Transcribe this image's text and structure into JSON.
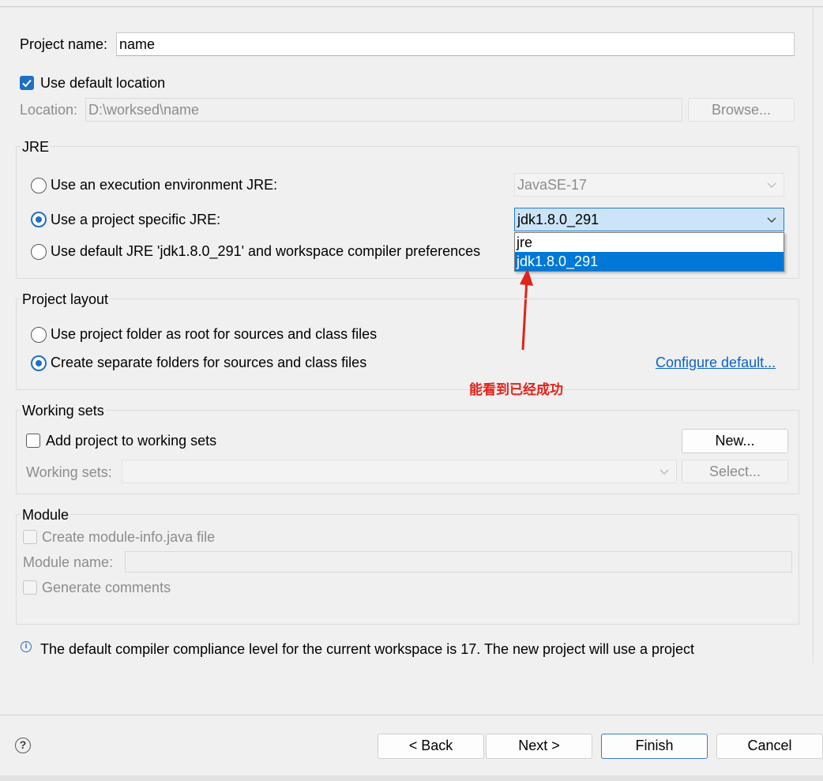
{
  "project": {
    "name_label": "Project name:",
    "name_value": "name",
    "use_default_location_label": "Use default location",
    "use_default_location_checked": true,
    "location_label": "Location:",
    "location_value": "D:\\worksed\\name",
    "browse_label": "Browse..."
  },
  "jre": {
    "group_label": "JRE",
    "option_execution_env": "Use an execution environment JRE:",
    "execution_env_value": "JavaSE-17",
    "option_project_specific": "Use a project specific JRE:",
    "project_specific_value": "jdk1.8.0_291",
    "option_default": "Use default JRE 'jdk1.8.0_291' and workspace compiler preferences",
    "selected": "project_specific",
    "dropdown_options": [
      "jre",
      "jdk1.8.0_291"
    ],
    "dropdown_selected_index": 1
  },
  "layout": {
    "group_label": "Project layout",
    "option_root": "Use project folder as root for sources and class files",
    "option_separate": "Create separate folders for sources and class files",
    "selected": "separate",
    "configure_link": "Configure default..."
  },
  "annotation": {
    "text": "能看到已经成功",
    "color": "#e0231b"
  },
  "working_sets": {
    "group_label": "Working sets",
    "add_label": "Add project to working sets",
    "add_checked": false,
    "new_button": "New...",
    "sets_label": "Working sets:",
    "sets_value": "",
    "select_button": "Select..."
  },
  "module": {
    "group_label": "Module",
    "create_info_label": "Create module-info.java file",
    "module_name_label": "Module name:",
    "module_name_value": "",
    "generate_comments_label": "Generate comments"
  },
  "info": {
    "icon": "info-icon",
    "message": "The default compiler compliance level for the current workspace is 17. The new project will use a project"
  },
  "footer": {
    "help_icon": "help-icon",
    "back_label": "< Back",
    "next_label": "Next >",
    "finish_label": "Finish",
    "cancel_label": "Cancel"
  },
  "colors": {
    "accent": "#1f6fc5",
    "selection": "#0078d7",
    "link": "#0a63c7",
    "annotation": "#e0231b"
  }
}
